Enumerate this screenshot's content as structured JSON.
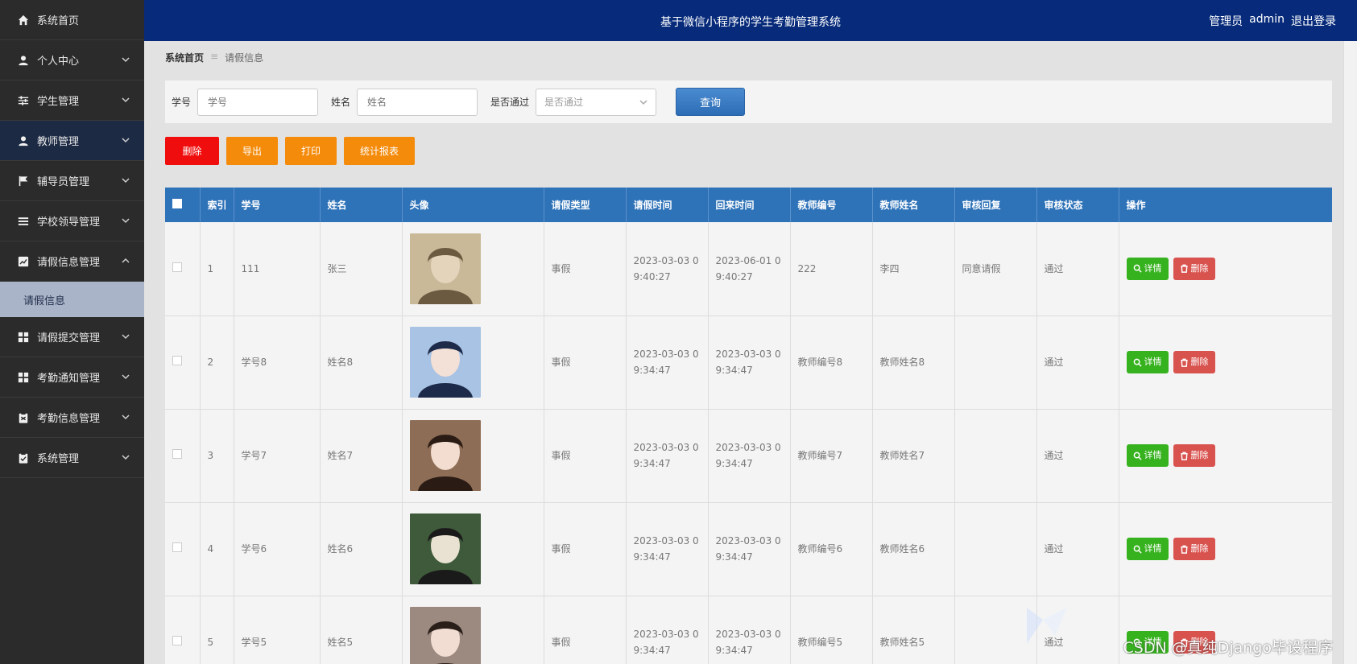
{
  "header": {
    "title": "基于微信小程序的学生考勤管理系统",
    "user_role": "管理员",
    "username": "admin",
    "logout": "退出登录"
  },
  "sidebar": {
    "items": [
      {
        "label": "系统首页",
        "icon": "home-icon"
      },
      {
        "label": "个人中心",
        "icon": "user-icon"
      },
      {
        "label": "学生管理",
        "icon": "sliders-icon"
      },
      {
        "label": "教师管理",
        "icon": "user-icon"
      },
      {
        "label": "辅导员管理",
        "icon": "flag-icon"
      },
      {
        "label": "学校领导管理",
        "icon": "list-icon"
      },
      {
        "label": "请假信息管理",
        "icon": "chart-icon"
      },
      {
        "label": "请假提交管理",
        "icon": "grid-icon"
      },
      {
        "label": "考勤通知管理",
        "icon": "grid-icon"
      },
      {
        "label": "考勤信息管理",
        "icon": "clipboard-icon"
      },
      {
        "label": "系统管理",
        "icon": "clipboard-check-icon"
      }
    ],
    "sub_item": "请假信息"
  },
  "breadcrumb": {
    "home": "系统首页",
    "separator": "≡",
    "current": "请假信息"
  },
  "search": {
    "student_id_label": "学号",
    "student_id_placeholder": "学号",
    "name_label": "姓名",
    "name_placeholder": "姓名",
    "approved_label": "是否通过",
    "approved_placeholder": "是否通过",
    "query_button": "查询"
  },
  "actions": {
    "delete": "删除",
    "export": "导出",
    "print": "打印",
    "report": "统计报表"
  },
  "table": {
    "columns": [
      "索引",
      "学号",
      "姓名",
      "头像",
      "请假类型",
      "请假时间",
      "回来时间",
      "教师编号",
      "教师姓名",
      "审核回复",
      "审核状态",
      "操作"
    ],
    "detail_label": "详情",
    "delete_label": "删除",
    "rows": [
      {
        "index": "1",
        "student_id": "111",
        "name": "张三",
        "leave_type": "事假",
        "leave_time": "2023-03-03 09:40:27",
        "return_time": "2023-06-01 09:40:27",
        "teacher_id": "222",
        "teacher_name": "李四",
        "reply": "同意请假",
        "status": "通过"
      },
      {
        "index": "2",
        "student_id": "学号8",
        "name": "姓名8",
        "leave_type": "事假",
        "leave_time": "2023-03-03 09:34:47",
        "return_time": "2023-03-03 09:34:47",
        "teacher_id": "教师编号8",
        "teacher_name": "教师姓名8",
        "reply": "",
        "status": "通过"
      },
      {
        "index": "3",
        "student_id": "学号7",
        "name": "姓名7",
        "leave_type": "事假",
        "leave_time": "2023-03-03 09:34:47",
        "return_time": "2023-03-03 09:34:47",
        "teacher_id": "教师编号7",
        "teacher_name": "教师姓名7",
        "reply": "",
        "status": "通过"
      },
      {
        "index": "4",
        "student_id": "学号6",
        "name": "姓名6",
        "leave_type": "事假",
        "leave_time": "2023-03-03 09:34:47",
        "return_time": "2023-03-03 09:34:47",
        "teacher_id": "教师编号6",
        "teacher_name": "教师姓名6",
        "reply": "",
        "status": "通过"
      },
      {
        "index": "5",
        "student_id": "学号5",
        "name": "姓名5",
        "leave_type": "事假",
        "leave_time": "2023-03-03 09:34:47",
        "return_time": "2023-03-03 09:34:47",
        "teacher_id": "教师编号5",
        "teacher_name": "教师姓名5",
        "reply": "",
        "status": "通过"
      }
    ]
  },
  "watermark": "CSDN @真纯Django毕设程序",
  "colors": {
    "header_bg": "#072b7a",
    "sidebar_bg": "#2b2b2b",
    "table_head": "#2e72b8",
    "delete_red": "#f00d0d",
    "orange": "#f48b0b",
    "detail_green": "#37b21f",
    "row_delete": "#d8524e"
  }
}
